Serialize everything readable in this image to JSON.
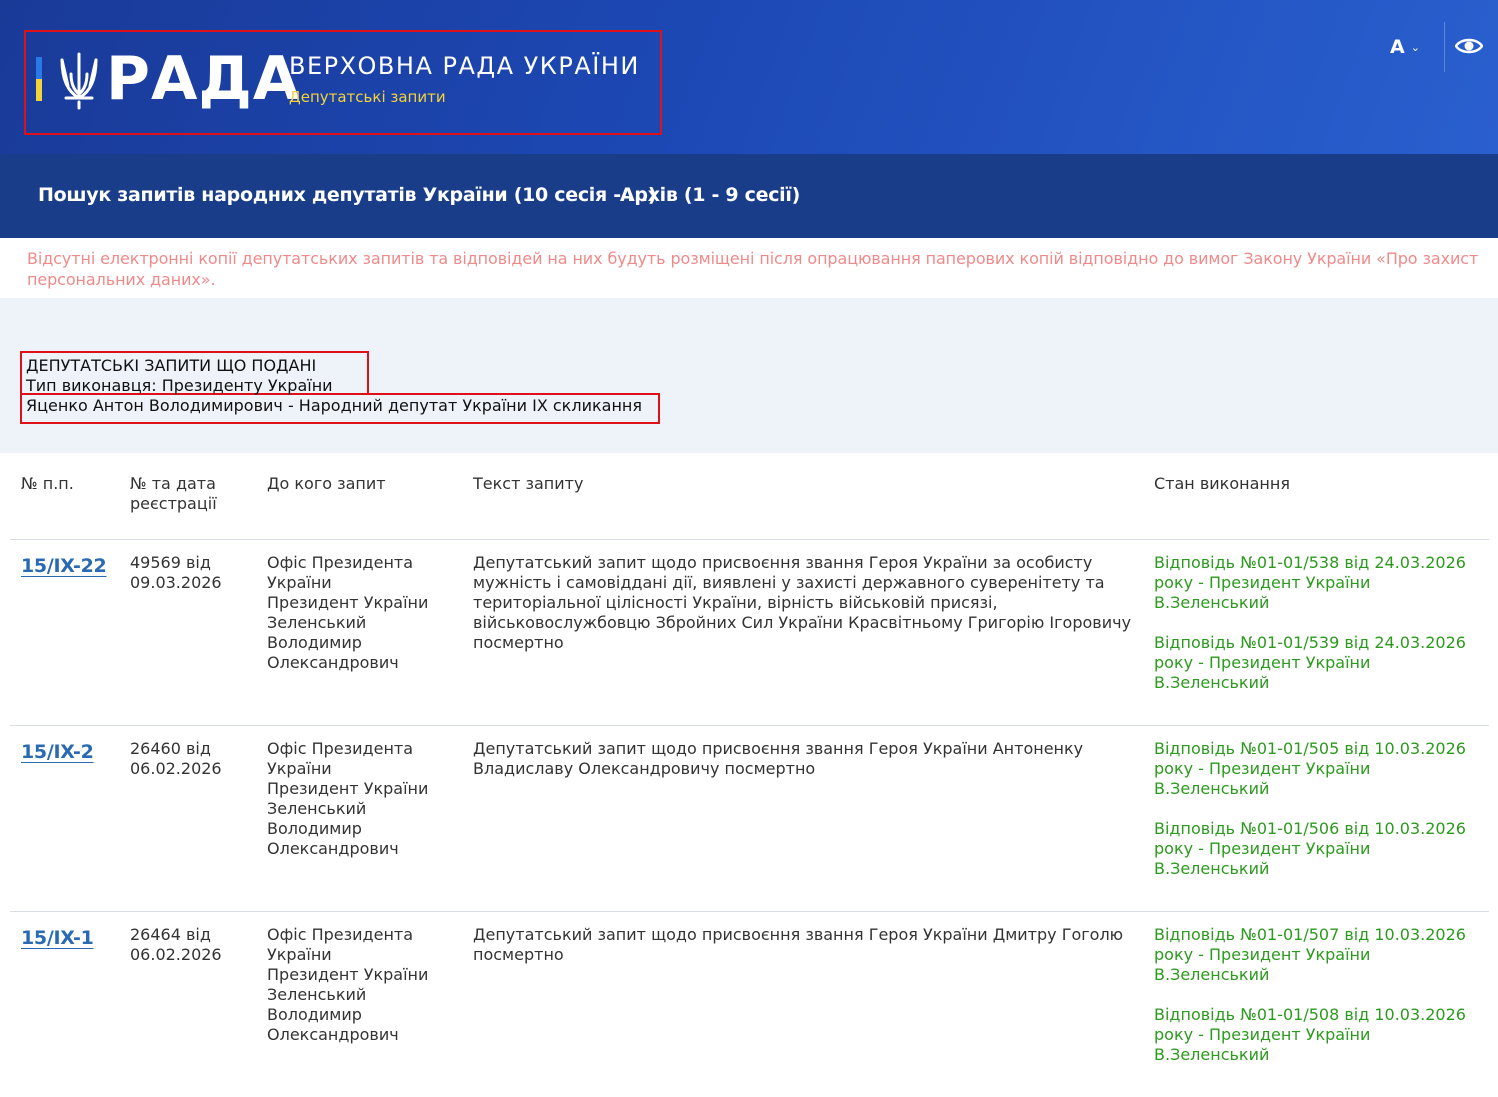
{
  "header": {
    "logo_word": "РАДА",
    "title": "ВЕРХОВНА РАДА УКРАЇНИ",
    "subtitle": "Депутатські запити",
    "font_button": "A",
    "colors": {
      "bg": "#1c48b4",
      "accent_yellow": "#f4d23a",
      "accent_blue": "#2a79e8"
    }
  },
  "nav": {
    "items": [
      {
        "label": "Пошук запитів народних депутатів України (10 сесія - ...)"
      },
      {
        "label": "Архів (1 - 9 сесії)"
      }
    ]
  },
  "notice": "Відсутні електронні копії депутатських запитів та відповідей на них будуть розміщені після опрацювання паперових копій відповідно до вимог Закону України «Про захист персональних даних».",
  "summary": {
    "line1": "ДЕПУТАТСЬКІ ЗАПИТИ ЩО ПОДАНІ",
    "line2": "Тип виконавця: Президенту України",
    "line3": "Яценко Антон Володимирович - Народний депутат України IX скликання"
  },
  "table": {
    "headers": {
      "num": "№ п.п.",
      "date_l1": "№ та дата",
      "date_l2": "реєстрації",
      "to": "До кого запит",
      "text": "Текст запиту",
      "status": "Стан виконання"
    },
    "rows": [
      {
        "num": "15/IX-22",
        "date_l1": "49569 від",
        "date_l2": "09.03.2026",
        "to": [
          "Офіс Президента",
          "України",
          "Президент України",
          "Зеленський",
          "Володимир",
          "Олександрович"
        ],
        "text": "Депутатський запит щодо присвоєння звання Героя України за особисту мужність і самовіддані дії, виявлені у захисті державного суверенітету та територіальної цілісності України, вірність військовій присязі, військовослужбовцю Збройних Сил України Красвітньому Григорію Ігоровичу посмертно",
        "answers": [
          [
            "Відповідь №01-01/538 від 24.03.2026",
            "року - Президент України",
            "В.Зеленський"
          ],
          [
            "Відповідь №01-01/539 від 24.03.2026",
            "року - Президент України",
            "В.Зеленський"
          ]
        ]
      },
      {
        "num": "15/IX-2",
        "date_l1": "26460 від",
        "date_l2": "06.02.2026",
        "to": [
          "Офіс Президента",
          "України",
          "Президент України",
          "Зеленський",
          "Володимир",
          "Олександрович"
        ],
        "text": "Депутатський запит щодо присвоєння звання Героя України Антоненку Владиславу Олександровичу посмертно",
        "answers": [
          [
            "Відповідь №01-01/505 від 10.03.2026",
            "року - Президент України",
            "В.Зеленський"
          ],
          [
            "Відповідь №01-01/506 від 10.03.2026",
            "року - Президент України",
            "В.Зеленський"
          ]
        ]
      },
      {
        "num": "15/IX-1",
        "date_l1": "26464 від",
        "date_l2": "06.02.2026",
        "to": [
          "Офіс Президента",
          "України",
          "Президент України",
          "Зеленський",
          "Володимир",
          "Олександрович"
        ],
        "text": "Депутатський запит щодо присвоєння звання Героя України Дмитру Гоголю посмертно",
        "answers": [
          [
            "Відповідь №01-01/507 від 10.03.2026",
            "року - Президент України",
            "В.Зеленський"
          ],
          [
            "Відповідь №01-01/508 від 10.03.2026",
            "року - Президент України",
            "В.Зеленський"
          ]
        ]
      }
    ]
  }
}
